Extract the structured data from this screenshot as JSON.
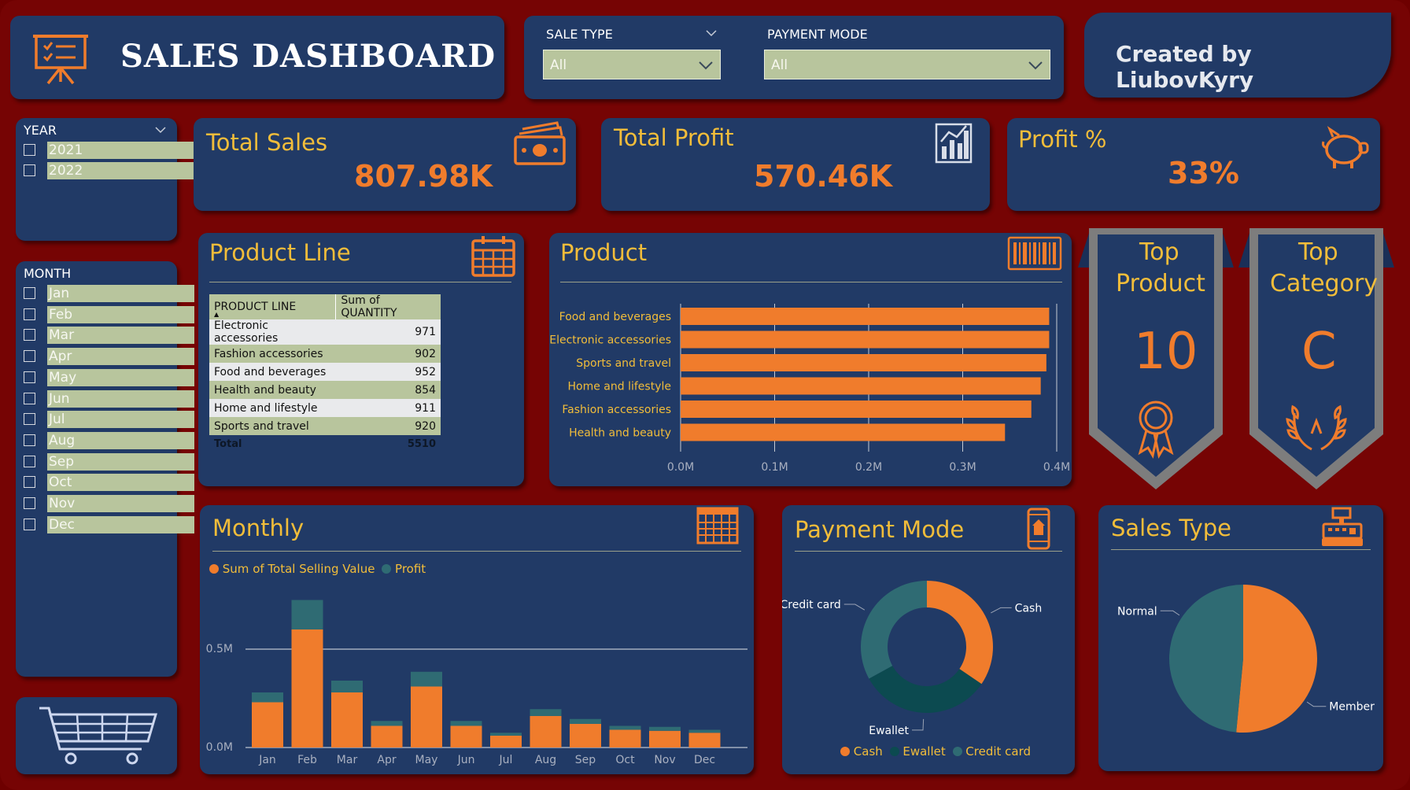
{
  "header": {
    "title": "SALES DASHBOARD",
    "credit": "Created by LiubovKyry"
  },
  "filters": {
    "sale_type": {
      "label": "SALE TYPE",
      "value": "All"
    },
    "payment_mode": {
      "label": "PAYMENT MODE",
      "value": "All"
    }
  },
  "year_slicer": {
    "label": "YEAR",
    "items": [
      {
        "label": "2021"
      },
      {
        "label": "2022"
      }
    ]
  },
  "month_slicer": {
    "label": "MONTH",
    "items": [
      {
        "label": "Jan"
      },
      {
        "label": "Feb"
      },
      {
        "label": "Mar"
      },
      {
        "label": "Apr"
      },
      {
        "label": "May"
      },
      {
        "label": "Jun"
      },
      {
        "label": "Jul"
      },
      {
        "label": "Aug"
      },
      {
        "label": "Sep"
      },
      {
        "label": "Oct"
      },
      {
        "label": "Nov"
      },
      {
        "label": "Dec"
      }
    ]
  },
  "kpis": {
    "total_sales": {
      "label": "Total Sales",
      "value": "807.98K",
      "icon": "money-icon"
    },
    "total_profit": {
      "label": "Total Profit",
      "value": "570.46K",
      "icon": "bar-chart-icon"
    },
    "profit_pct": {
      "label": "Profit %",
      "value": "33%",
      "icon": "piggy-bank-icon"
    }
  },
  "product_line": {
    "title": "Product Line",
    "headers": [
      "PRODUCT LINE",
      "Sum of QUANTITY"
    ],
    "rows": [
      {
        "name": "Electronic accessories",
        "qty": "971"
      },
      {
        "name": "Fashion accessories",
        "qty": "902"
      },
      {
        "name": "Food and beverages",
        "qty": "952"
      },
      {
        "name": "Health and beauty",
        "qty": "854"
      },
      {
        "name": "Home and lifestyle",
        "qty": "911"
      },
      {
        "name": "Sports and travel",
        "qty": "920"
      }
    ],
    "total_label": "Total",
    "total_value": "5510"
  },
  "product": {
    "title": "Product"
  },
  "top_product": {
    "line1": "Top",
    "line2": "Product",
    "value": "10"
  },
  "top_category": {
    "line1": "Top",
    "line2": "Category",
    "value": "C"
  },
  "monthly": {
    "title": "Monthly",
    "legend": [
      "Sum of Total Selling Value",
      "Profit"
    ]
  },
  "payment_mode": {
    "title": "Payment Mode",
    "legend": [
      "Cash",
      "Ewallet",
      "Credit card"
    ]
  },
  "sales_type": {
    "title": "Sales Type"
  },
  "colors": {
    "background": "#760404",
    "card": "#213a66",
    "orange": "#f07c2c",
    "gold": "#f2bd3a",
    "teal": "#2f6b73",
    "dark_teal": "#0c4a50",
    "slicer_green": "#b8c59d"
  },
  "chart_data": [
    {
      "type": "bar",
      "orientation": "horizontal",
      "categories": [
        "Food and beverages",
        "Electronic accessories",
        "Sports and travel",
        "Home and lifestyle",
        "Fashion accessories",
        "Health and beauty"
      ],
      "values": [
        0.392,
        0.392,
        0.389,
        0.383,
        0.373,
        0.345
      ],
      "xlim": [
        0,
        0.4
      ],
      "xticks": [
        "0.0M",
        "0.1M",
        "0.2M",
        "0.3M",
        "0.4M"
      ],
      "grid": true
    },
    {
      "type": "bar",
      "stacked": true,
      "categories": [
        "Jan",
        "Feb",
        "Mar",
        "Apr",
        "May",
        "Jun",
        "Jul",
        "Aug",
        "Sep",
        "Oct",
        "Nov",
        "Dec"
      ],
      "series": [
        {
          "name": "Sum of Total Selling Value",
          "values": [
            0.23,
            0.6,
            0.28,
            0.11,
            0.31,
            0.11,
            0.06,
            0.16,
            0.12,
            0.09,
            0.085,
            0.075
          ]
        },
        {
          "name": "Profit",
          "values": [
            0.05,
            0.15,
            0.06,
            0.025,
            0.075,
            0.025,
            0.015,
            0.035,
            0.025,
            0.02,
            0.02,
            0.015
          ]
        }
      ],
      "ylim": [
        0,
        0.75
      ],
      "yticks": [
        "0.0M",
        "0.5M"
      ],
      "legend": "top-left"
    },
    {
      "type": "pie",
      "donut": true,
      "labels": [
        "Cash",
        "Ewallet",
        "Credit card"
      ],
      "values": [
        34.5,
        32.5,
        33
      ],
      "colors": [
        "#f07c2c",
        "#0c4a50",
        "#2f6b73"
      ],
      "legend": "bottom"
    },
    {
      "type": "pie",
      "labels": [
        "Member",
        "Normal"
      ],
      "values": [
        51.5,
        48.5
      ],
      "colors": [
        "#f07c2c",
        "#2f6b73"
      ]
    }
  ]
}
